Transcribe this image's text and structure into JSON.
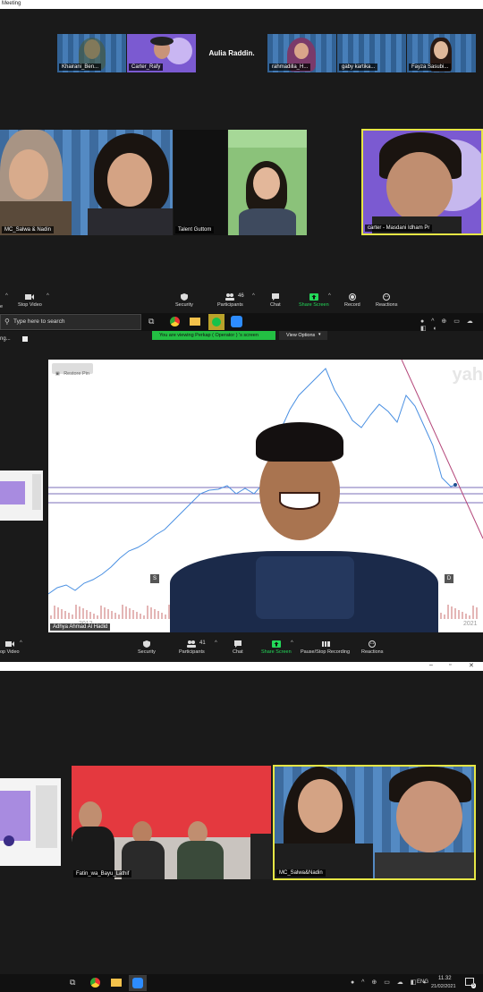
{
  "window_title": "Meeting",
  "session1": {
    "thumbs": [
      {
        "name": "Khairani_Ben..."
      },
      {
        "name": "Carter_Rafy"
      },
      {
        "name": "Aulia Raddin."
      },
      {
        "name": "rahmadilla_H..."
      },
      {
        "name": "gaby kartika..."
      },
      {
        "name": "Fayza Sasubi..."
      }
    ],
    "tiles": [
      {
        "name": "MC_Salwa & Nadin"
      },
      {
        "name": "Talent Guttom"
      },
      {
        "name": "carter - Masdani Idham Pr"
      }
    ],
    "toolbar": {
      "stop_video": "Stop Video",
      "security": "Security",
      "participants": "Participants",
      "participant_count": "46",
      "chat": "Chat",
      "share_screen": "Share Screen",
      "record": "Record",
      "reactions": "Reactions",
      "left_partial": "e"
    },
    "taskbar": {
      "search_placeholder": "Type here to search"
    }
  },
  "session2": {
    "banner": "You are viewing Perkap ( Operator ) 's screen",
    "view_options": "View Options",
    "left_partial": "ng...",
    "chart_overlay": {
      "restore_pin": "Restore Pin",
      "watermark": "yah",
      "year_left": "2012",
      "year_right": "2021",
      "marker_s": "S",
      "marker_d1": "D",
      "marker_d2": "D",
      "speaker_name": "Adhya Ahmad Al Hadid"
    },
    "toolbar": {
      "stop_video": "op Video",
      "security": "Security",
      "participants": "Participants",
      "participant_count": "41",
      "chat": "Chat",
      "share_screen": "Share Screen",
      "pause_record": "Pause/Stop Recording",
      "reactions": "Reactions"
    }
  },
  "session3": {
    "tiles": [
      {
        "name": "Fatin_wa_Bayu_Lathif"
      },
      {
        "name": "MC_Salwa&Nadin"
      }
    ],
    "taskbar": {
      "lang": "ENG",
      "time": "11.32",
      "date": "21/02/2021",
      "notification_count": "5"
    }
  },
  "colors": {
    "share_green": "#23d959",
    "active_border": "#e6e645",
    "purple_bg": "#7b5ad1",
    "banner_green": "#23bf43",
    "chart_line": "#4a90e2"
  }
}
